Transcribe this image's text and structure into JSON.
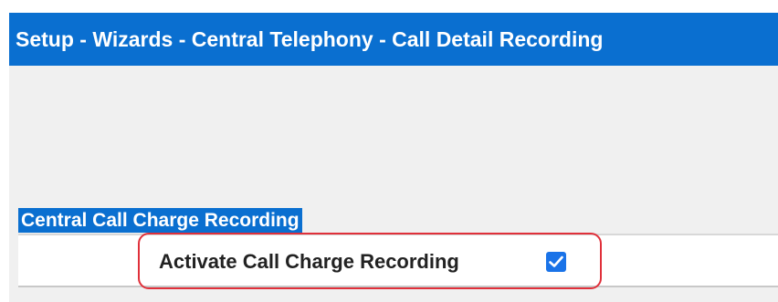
{
  "header": {
    "title": "Setup - Wizards - Central Telephony - Call Detail Recording"
  },
  "section": {
    "title": "Central Call Charge Recording",
    "fields": {
      "activate_label": "Activate Call Charge Recording",
      "activate_checked": true
    }
  },
  "colors": {
    "header_bg": "#0a6fd0",
    "panel_bg": "#f0f0f0",
    "highlight": "#e0303a",
    "checkbox": "#1a73e8"
  },
  "icons": {
    "checkbox": "checkmark-icon"
  }
}
